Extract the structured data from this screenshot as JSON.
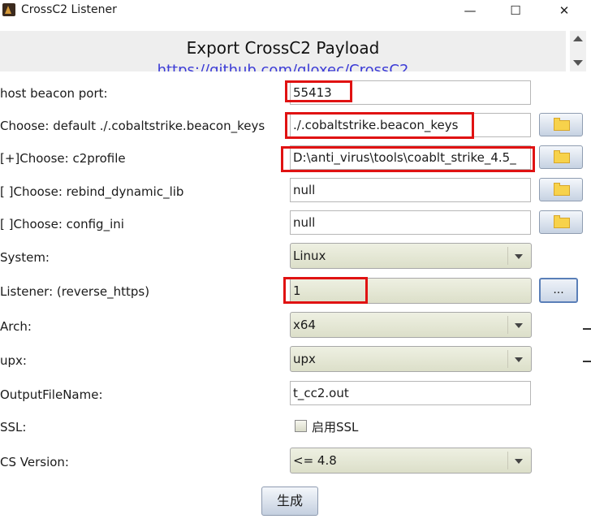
{
  "window": {
    "title": "CrossC2 Listener",
    "minimize_glyph": "—",
    "maximize_glyph": "☐",
    "close_glyph": "✕"
  },
  "header": {
    "title": "Export CrossC2 Payload",
    "link_partial": "https://github.com/gloxec/CrossC2"
  },
  "form": {
    "port_label": "host beacon port:",
    "port_value": "55413",
    "keys_label": "Choose: default ./.cobaltstrike.beacon_keys",
    "keys_value": "./.cobaltstrike.beacon_keys",
    "profile_label": "[+]Choose: c2profile",
    "profile_value": "D:\\anti_virus\\tools\\coablt_strike_4.5_",
    "rebind_label": "[ ]Choose: rebind_dynamic_lib",
    "rebind_value": "null",
    "config_label": "[ ]Choose: config_ini",
    "config_value": "null",
    "system_label": "System:",
    "system_value": "Linux",
    "listener_label": "Listener: (reverse_https)",
    "listener_value": "1",
    "listener_button": "...",
    "arch_label": "Arch:",
    "arch_value": "x64",
    "upx_label": "upx:",
    "upx_value": "upx",
    "output_label": "OutputFileName:",
    "output_value": "t_cc2.out",
    "ssl_label": "SSL:",
    "ssl_checkbox_label": "启用SSL",
    "ssl_checked": false,
    "cs_label": "CS Version:",
    "cs_value": "<= 4.8",
    "generate_button": "生成"
  },
  "colors": {
    "highlight": "#e01212",
    "combo_fill": "#dcdfc9",
    "button_fill": "#c4cfdf"
  },
  "icons": {
    "folder": "folder-icon",
    "dropdown": "chevron-down-icon"
  }
}
